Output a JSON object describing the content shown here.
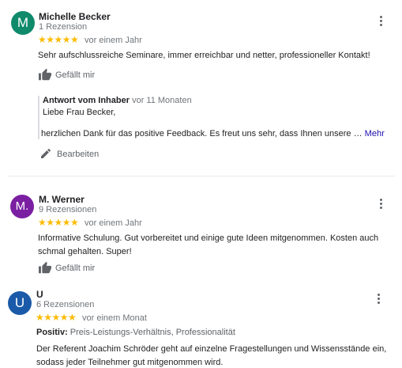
{
  "reviews": [
    {
      "avatar_letter": "M",
      "avatar_color": "#0f8a6b",
      "name": "Michelle Becker",
      "count": "1 Rezension",
      "stars": "★★★★★",
      "date": "vor einem Jahr",
      "text": "Sehr aufschlussreiche Seminare, immer erreichbar und netter, professioneller Kontakt!",
      "like_label": "Gefällt mir",
      "owner_reply": {
        "title": "Antwort vom Inhaber",
        "date": "vor 11 Monaten",
        "line1": "Liebe Frau Becker,",
        "line2": "herzlichen Dank für das positive Feedback. Es freut uns sehr, dass Ihnen unsere …",
        "more": "Mehr"
      },
      "edit_label": "Bearbeiten"
    },
    {
      "avatar_letter": "M.",
      "avatar_color": "#7b1fa2",
      "name": "M. Werner",
      "count": "9 Rezensionen",
      "stars": "★★★★★",
      "date": "vor einem Jahr",
      "text": "Informative Schulung. Gut vorbereitet und einige gute Ideen mitgenommen. Kosten auch schmal gehalten. Super!",
      "like_label": "Gefällt mir"
    },
    {
      "avatar_letter": "U",
      "avatar_color": "#1a5aa8",
      "name": "U",
      "count": "6 Rezensionen",
      "stars": "★★★★★",
      "date": "vor einem Monat",
      "positive_label": "Positiv:",
      "positive_value": "Preis-Leistungs-Verhältnis, Professionalität",
      "text": "Der Referent Joachim Schröder geht auf einzelne Fragestellungen und Wissensstände ein, sodass jeder Teilnehmer gut mitgenommen wird."
    }
  ]
}
